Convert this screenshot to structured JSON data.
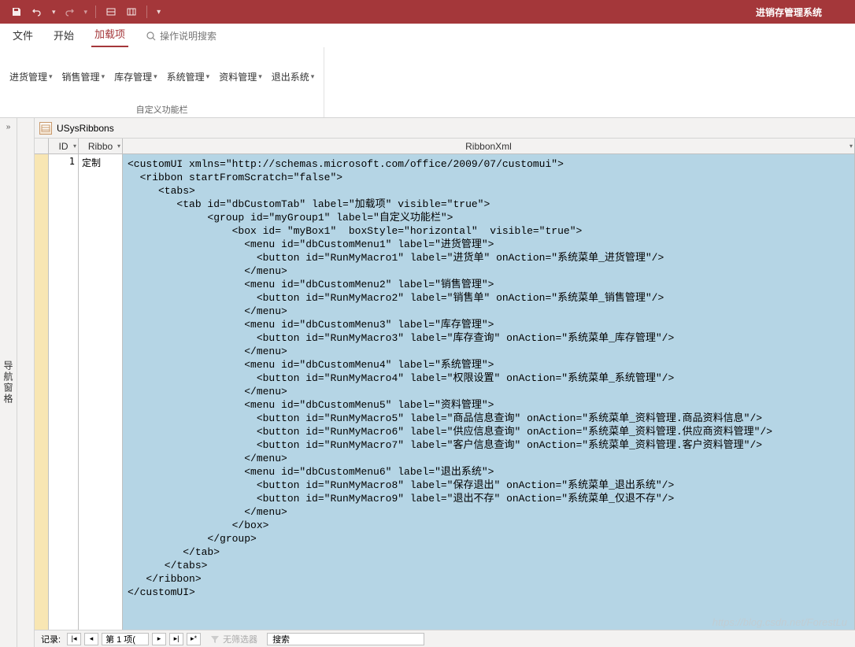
{
  "app_title": "进销存管理系统",
  "menutabs": {
    "file": "文件",
    "home": "开始",
    "addin": "加载项",
    "search_hint": "操作说明搜索"
  },
  "ribbon": {
    "items": [
      "进货管理",
      "销售管理",
      "库存管理",
      "系统管理",
      "资料管理",
      "退出系统"
    ],
    "group_label": "自定义功能栏"
  },
  "nav_pane_label": "导航窗格",
  "object_tab": "USysRibbons",
  "columns": {
    "id": "ID",
    "ribbo": "Ribbo",
    "xml": "RibbonXml"
  },
  "row": {
    "id": "1",
    "ribbo": "定制",
    "xml": "<customUI xmlns=\"http://schemas.microsoft.com/office/2009/07/customui\">\n  <ribbon startFromScratch=\"false\">\n     <tabs>\n        <tab id=\"dbCustomTab\" label=\"加载项\" visible=\"true\">\n             <group id=\"myGroup1\" label=\"自定义功能栏\">\n                 <box id= \"myBox1\"  boxStyle=\"horizontal\"  visible=\"true\">\n                   <menu id=\"dbCustomMenu1\" label=\"进货管理\">\n                     <button id=\"RunMyMacro1\" label=\"进货单\" onAction=\"系统菜单_进货管理\"/>\n                   </menu>\n                   <menu id=\"dbCustomMenu2\" label=\"销售管理\">\n                     <button id=\"RunMyMacro2\" label=\"销售单\" onAction=\"系统菜单_销售管理\"/>\n                   </menu>\n                   <menu id=\"dbCustomMenu3\" label=\"库存管理\">\n                     <button id=\"RunMyMacro3\" label=\"库存查询\" onAction=\"系统菜单_库存管理\"/>\n                   </menu>\n                   <menu id=\"dbCustomMenu4\" label=\"系统管理\">\n                     <button id=\"RunMyMacro4\" label=\"权限设置\" onAction=\"系统菜单_系统管理\"/>\n                   </menu>\n                   <menu id=\"dbCustomMenu5\" label=\"资料管理\">\n                     <button id=\"RunMyMacro5\" label=\"商品信息查询\" onAction=\"系统菜单_资料管理.商品资料信息\"/>\n                     <button id=\"RunMyMacro6\" label=\"供应信息查询\" onAction=\"系统菜单_资料管理.供应商资料管理\"/>\n                     <button id=\"RunMyMacro7\" label=\"客户信息查询\" onAction=\"系统菜单_资料管理.客户资料管理\"/>\n                   </menu>\n                   <menu id=\"dbCustomMenu6\" label=\"退出系统\">\n                     <button id=\"RunMyMacro8\" label=\"保存退出\" onAction=\"系统菜单_退出系统\"/>\n                     <button id=\"RunMyMacro9\" label=\"退出不存\" onAction=\"系统菜单_仅退不存\"/>\n                   </menu>\n                 </box>\n             </group>\n         </tab>\n      </tabs>\n   </ribbon>\n</customUI>"
  },
  "navbar": {
    "record_label": "记录:",
    "record_pos": "第 1 项(",
    "no_filter": "无筛选器",
    "search": "搜索"
  },
  "watermark": "https://blog.csdn.net/ForestLu"
}
